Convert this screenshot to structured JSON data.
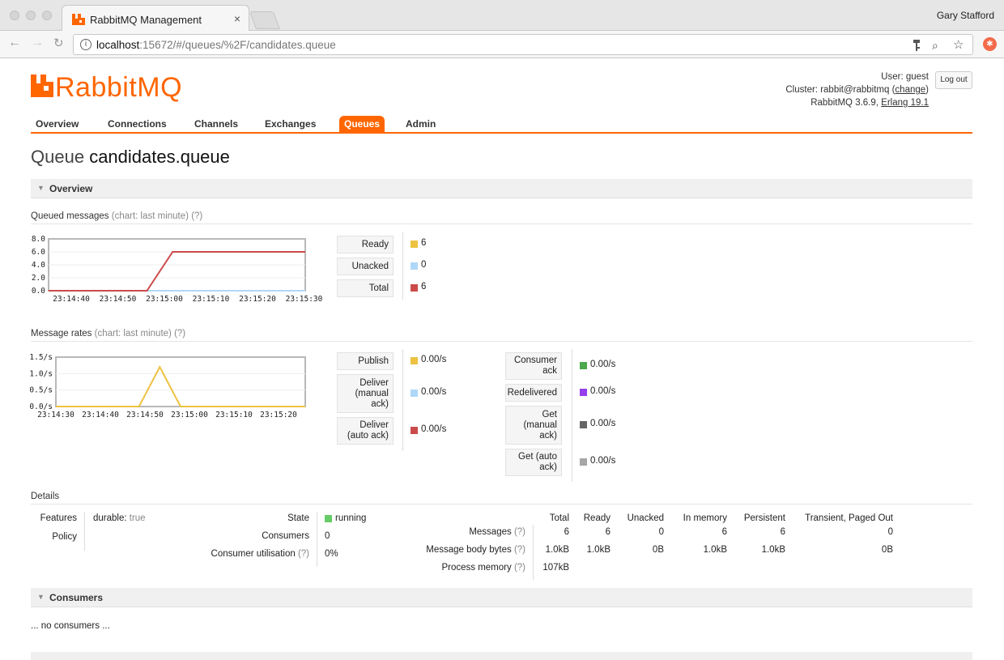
{
  "browser": {
    "tab_title": "RabbitMQ Management",
    "tab_close": "×",
    "profile_name": "Gary Stafford",
    "url_host": "localhost",
    "url_rest": ":15672/#/queues/%2F/candidates.queue",
    "info_icon": "i",
    "key_icon": "key-icon",
    "zoom_icon": "⌕",
    "star_icon": "☆",
    "ext_icon": "✱"
  },
  "header": {
    "logo_text": "RabbitMQ",
    "user_label": "User:",
    "user_name": "guest",
    "cluster_label": "Cluster:",
    "cluster_name": "rabbit@rabbitmq",
    "change_link": "change",
    "version_text": "RabbitMQ 3.6.9,",
    "erlang_link": "Erlang 19.1",
    "logout_label": "Log out"
  },
  "menu": [
    "Overview",
    "Connections",
    "Channels",
    "Exchanges",
    "Queues",
    "Admin"
  ],
  "page_title_prefix": "Queue",
  "page_title_name": "candidates.queue",
  "overview_section": "Overview",
  "queued": {
    "label": "Queued messages",
    "chart_hint": "(chart: last minute)",
    "help": "(?)",
    "stats": [
      {
        "label": "Ready",
        "value": "6",
        "color": "#edc240"
      },
      {
        "label": "Unacked",
        "value": "0",
        "color": "#afd8f8"
      },
      {
        "label": "Total",
        "value": "6",
        "color": "#cb4b4b"
      }
    ]
  },
  "rates": {
    "label": "Message rates",
    "chart_hint": "(chart: last minute)",
    "help": "(?)",
    "left": [
      {
        "label": "Publish",
        "value": "0.00/s",
        "color": "#edc240"
      },
      {
        "label": "Deliver (manual ack)",
        "value": "0.00/s",
        "color": "#afd8f8"
      },
      {
        "label": "Deliver (auto ack)",
        "value": "0.00/s",
        "color": "#cb4b4b"
      }
    ],
    "right": [
      {
        "label": "Consumer ack",
        "value": "0.00/s",
        "color": "#4da74d"
      },
      {
        "label": "Redelivered",
        "value": "0.00/s",
        "color": "#9440ed"
      },
      {
        "label": "Get (manual ack)",
        "value": "0.00/s",
        "color": "#666666"
      },
      {
        "label": "Get (auto ack)",
        "value": "0.00/s",
        "color": "#a6a6a6"
      }
    ]
  },
  "chart_data": [
    {
      "type": "line",
      "x": [
        "23:14:40",
        "23:14:50",
        "23:15:00",
        "23:15:10",
        "23:15:20",
        "23:15:30"
      ],
      "ylim": [
        0,
        8
      ],
      "yticks": [
        "8.0",
        "6.0",
        "4.0",
        "2.0",
        "0.0"
      ],
      "series": [
        {
          "name": "Total",
          "color": "#cb4b4b",
          "points": [
            [
              0,
              0
            ],
            [
              23,
              0
            ],
            [
              29,
              6
            ],
            [
              60,
              6
            ]
          ]
        },
        {
          "name": "Unacked",
          "color": "#afd8f8",
          "points": [
            [
              0,
              0
            ],
            [
              60,
              0
            ]
          ]
        }
      ],
      "x_range_seconds": [
        0,
        60
      ]
    },
    {
      "type": "line",
      "x": [
        "23:14:30",
        "23:14:40",
        "23:14:50",
        "23:15:00",
        "23:15:10",
        "23:15:20"
      ],
      "ylim": [
        0,
        1.5
      ],
      "yticks": [
        "1.5/s",
        "1.0/s",
        "0.5/s",
        "0.0/s"
      ],
      "series": [
        {
          "name": "Publish",
          "color": "#edc240",
          "points": [
            [
              0,
              0
            ],
            [
              20,
              0
            ],
            [
              25,
              1.2
            ],
            [
              30,
              0
            ],
            [
              60,
              0
            ]
          ]
        }
      ],
      "x_range_seconds": [
        0,
        60
      ]
    }
  ],
  "details": {
    "label": "Details",
    "features_label": "Features",
    "features_key": "durable:",
    "features_val": "true",
    "policy_label": "Policy",
    "state_label": "State",
    "state_val": "running",
    "state_color": "#66cc66",
    "consumers_label": "Consumers",
    "consumers_val": "0",
    "util_label": "Consumer utilisation",
    "util_val": "0%",
    "help": "(?)",
    "table_headers": [
      "Total",
      "Ready",
      "Unacked",
      "In memory",
      "Persistent",
      "Transient, Paged Out"
    ],
    "rows": [
      {
        "label": "Messages",
        "values": [
          "6",
          "6",
          "0",
          "6",
          "6",
          "0"
        ]
      },
      {
        "label": "Message body bytes",
        "values": [
          "1.0kB",
          "1.0kB",
          "0B",
          "1.0kB",
          "1.0kB",
          "0B"
        ]
      },
      {
        "label": "Process memory",
        "values": [
          "107kB"
        ]
      }
    ]
  },
  "consumers_section": "Consumers",
  "no_consumers": "... no consumers ..."
}
